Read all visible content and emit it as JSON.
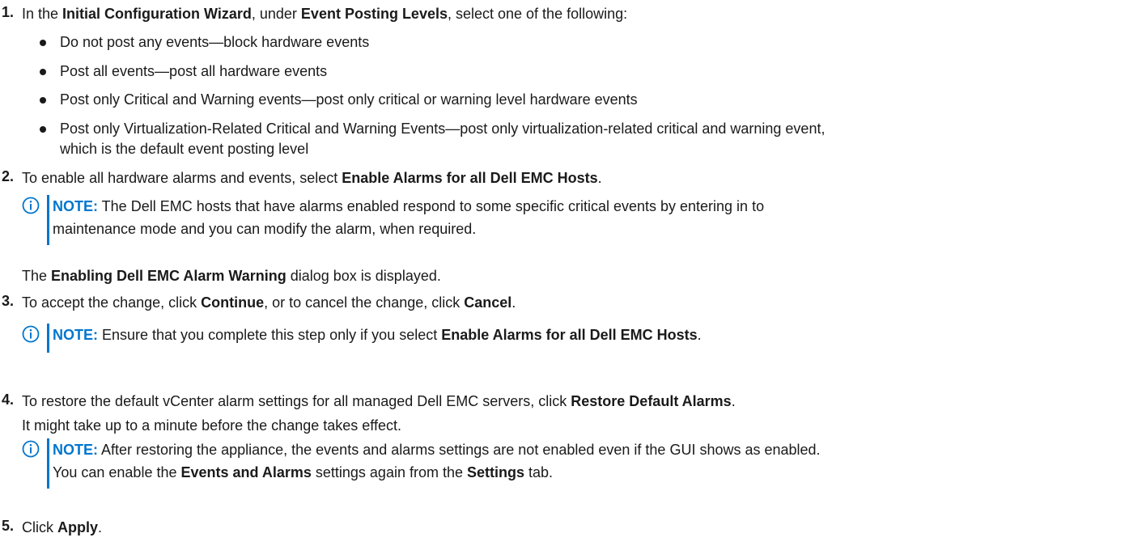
{
  "steps": [
    {
      "number": "1.",
      "parts": [
        "In the ",
        "Initial Configuration Wizard",
        ", under ",
        "Event Posting Levels",
        ", select one of the following:"
      ],
      "bullets": [
        "Do not post any events—block hardware events",
        "Post all events—post all hardware events",
        "Post only Critical and Warning events—post only critical or warning level hardware events",
        "Post only Virtualization-Related Critical and Warning Events—post only virtualization-related critical and warning event,",
        "which is the default event posting level"
      ]
    },
    {
      "number": "2.",
      "parts": [
        "To enable all hardware alarms and events, select ",
        "Enable Alarms for all Dell EMC Hosts",
        "."
      ],
      "note": {
        "label": "NOTE:",
        "line1": " The Dell EMC hosts that have alarms enabled respond to some specific critical events by entering in to",
        "line2": "maintenance mode and you can modify the alarm, when required."
      },
      "after": [
        "The ",
        "Enabling Dell EMC Alarm Warning",
        " dialog box is displayed."
      ]
    },
    {
      "number": "3.",
      "parts": [
        "To accept the change, click ",
        "Continue",
        ", or to cancel the change, click ",
        "Cancel",
        "."
      ],
      "note": {
        "label": "NOTE:",
        "parts": [
          " Ensure that you complete this step only if you select ",
          "Enable Alarms for all Dell EMC Hosts",
          "."
        ]
      }
    },
    {
      "number": "4.",
      "parts": [
        "To restore the default vCenter alarm settings for all managed Dell EMC servers, click ",
        "Restore Default Alarms",
        "."
      ],
      "sub": "It might take up to a minute before the change takes effect.",
      "note": {
        "label": "NOTE:",
        "line1": " After restoring the appliance, the events and alarms settings are not enabled even if the GUI shows as enabled.",
        "line2_parts": [
          "You can enable the ",
          "Events and Alarms",
          " settings again from the ",
          "Settings",
          " tab."
        ]
      }
    },
    {
      "number": "5.",
      "parts": [
        "Click ",
        "Apply",
        "."
      ]
    }
  ],
  "colors": {
    "accent": "#0076ce",
    "text": "#1a1a1a"
  },
  "icons": {
    "note": "info-circle-icon"
  }
}
